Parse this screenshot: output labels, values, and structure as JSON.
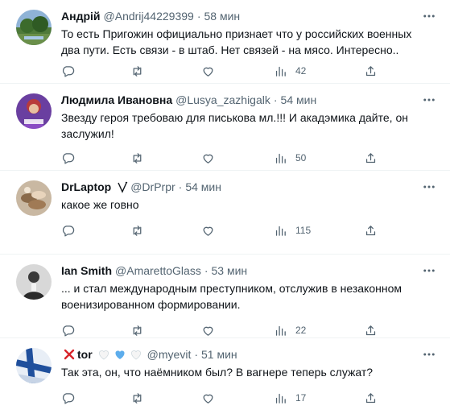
{
  "tweets": [
    {
      "name": "Андрій",
      "handle": "@Andrij44229399",
      "sep": "·",
      "time": "58 мин",
      "text": "То есть Пригожин официально признает что у российских военных два пути. Есть связи - в штаб. Нет связей - на мясо. Интересно..",
      "views": "42"
    },
    {
      "name": "Людмила Ивановна",
      "handle": "@Lusya_zazhigalk",
      "sep": "·",
      "time": "54 мин",
      "text": "Звезду героя требоваю для писькова мл.!!! И акадэмика дайте, он заслужил!",
      "views": "50"
    },
    {
      "name": "DrLaptop",
      "handle": "@DrPrpr",
      "sep": "·",
      "time": "54 мин",
      "text": "какое же говно",
      "views": "115",
      "badge_icon": "vee-badge-icon"
    },
    {
      "name": "Ian Smith",
      "handle": "@AmarettoGlass",
      "sep": "·",
      "time": "53 мин",
      "text": "... и стал международным преступником, отслужив в незаконном военизированном формировании.",
      "views": "22"
    },
    {
      "name": "tor",
      "handle": "@myevit",
      "sep": "·",
      "time": "51 мин",
      "text": "Так эта, он, что наёмником был? В вагнере теперь служат?",
      "views": "17",
      "name_prefix_icon": "red-cross-icon",
      "name_suffix_icons": [
        "white-heart-icon",
        "blue-heart-icon",
        "white-heart-icon"
      ]
    }
  ],
  "colors": {
    "text": "#0f1419",
    "secondary": "#536471",
    "divider": "#eff3f4",
    "red_x": "#d8242a",
    "blue_heart": "#5dadec"
  }
}
